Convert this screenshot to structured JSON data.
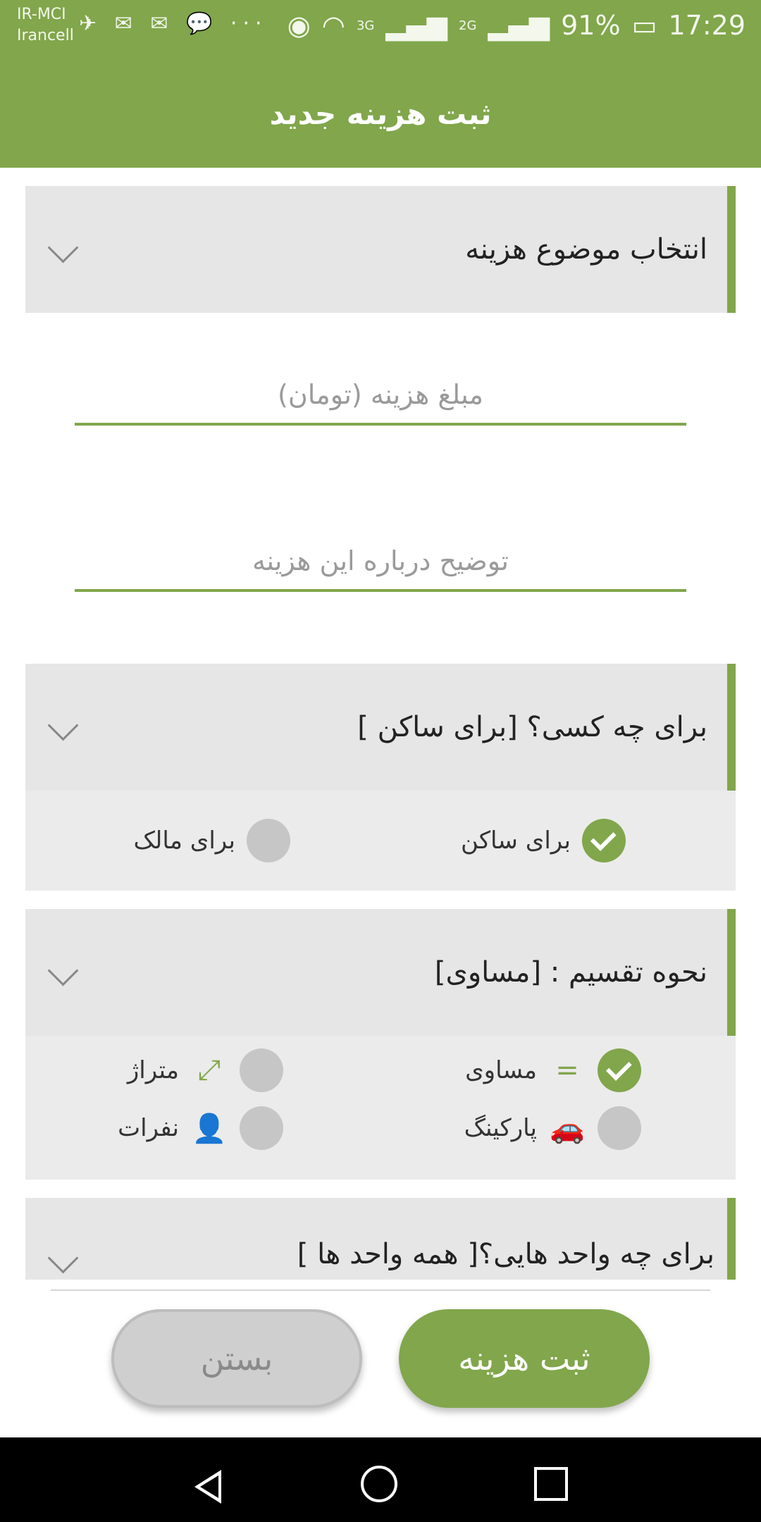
{
  "statusbar": {
    "carrier1": "IR-MCI",
    "carrier2": "Irancell",
    "left_icons": "✈ ✉ ✉ 💬 ···",
    "net1": "3G",
    "net2": "2G",
    "battery": "91%",
    "time": "17:29"
  },
  "appbar": {
    "title": "ثبت هزینه جدید"
  },
  "subject": {
    "label": "انتخاب موضوع هزینه"
  },
  "amount": {
    "placeholder": "مبلغ هزینه (تومان)"
  },
  "description": {
    "placeholder": "توضیح درباره این هزینه"
  },
  "for_whom": {
    "title": "برای چه کسی؟ [برای ساکن ]",
    "options": [
      {
        "label": "برای ساکن",
        "selected": true
      },
      {
        "label": "برای مالک",
        "selected": false
      }
    ]
  },
  "division": {
    "title": "نحوه تقسیم : [مساوی]",
    "options": [
      {
        "label": "مساوی",
        "icon": "equals-icon",
        "selected": true
      },
      {
        "label": "متراژ",
        "icon": "resize-icon",
        "selected": false
      },
      {
        "label": "پارکینگ",
        "icon": "car-icon",
        "selected": false
      },
      {
        "label": "نفرات",
        "icon": "person-icon",
        "selected": false
      }
    ]
  },
  "units": {
    "title": "برای چه واحد هایی؟[ همه واحد ها ]"
  },
  "buttons": {
    "save": "ثبت هزینه",
    "close": "بستن"
  },
  "colors": {
    "accent": "#81a64b",
    "panel": "#ebebeb"
  }
}
